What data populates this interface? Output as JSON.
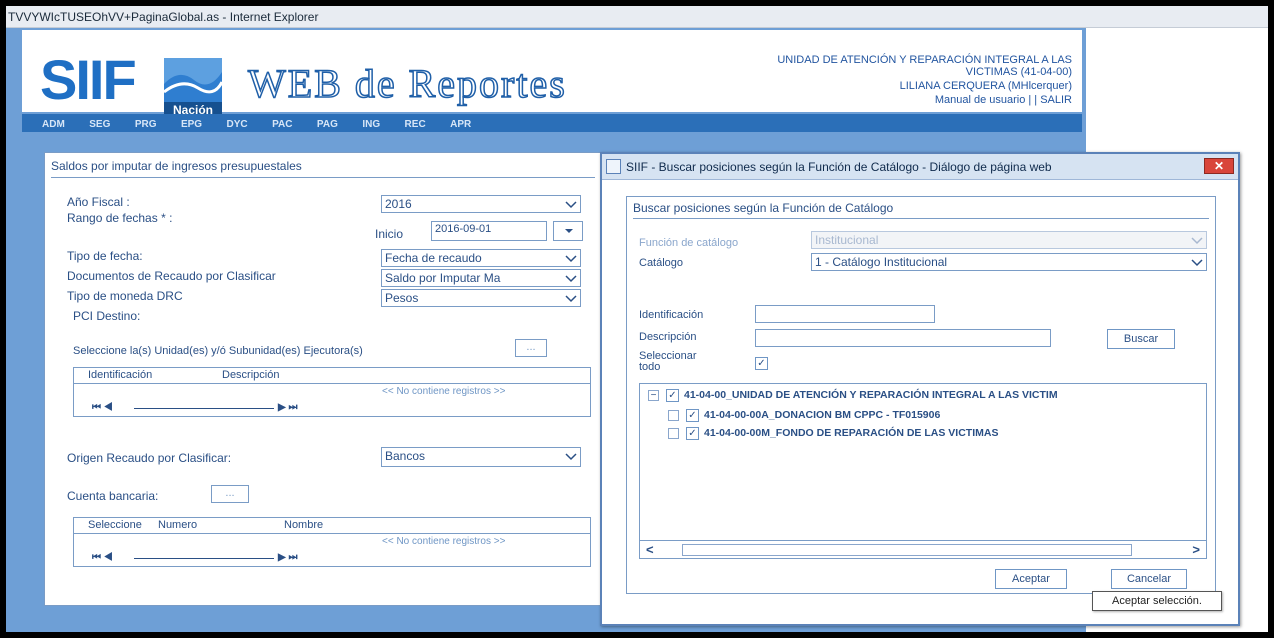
{
  "window": {
    "title": "TVVYWIcTUSEOhVV+PaginaGlobal.as - Internet Explorer"
  },
  "header": {
    "logo_main": "SIIF",
    "logo_sub": "Nación",
    "logo_title": "WEB de Reportes",
    "entity_line1": "UNIDAD DE ATENCIÓN Y REPARACIÓN INTEGRAL A LAS",
    "entity_line2": "VICTIMAS (41-04-00)",
    "user": "LILIANA CERQUERA (MHlcerquer)",
    "links": "Manual de usuario | | SALIR"
  },
  "nav": {
    "items": [
      "ADM",
      "SEG",
      "PRG",
      "EPG",
      "DYC",
      "PAC",
      "PAG",
      "ING",
      "REC",
      "APR"
    ]
  },
  "form": {
    "title": "Saldos por imputar de ingresos presupuestales",
    "anio_label": "Año Fiscal :",
    "anio_value": "2016",
    "rango_label": "Rango de fechas * :",
    "inicio_label": "Inicio",
    "inicio_value": "2016-09-01",
    "tipo_fecha_label": "Tipo de fecha:",
    "tipo_fecha_value": "Fecha de recaudo",
    "docs_label": "Documentos de Recaudo por Clasificar",
    "docs_value": "Saldo por Imputar Ma",
    "moneda_label": "Tipo de moneda DRC",
    "moneda_value": "Pesos",
    "pci_label": "PCI Destino:",
    "unidades_label": "Seleccione la(s) Unidad(es) y/ó Subunidad(es) Ejecutora(s)",
    "unidades_btn": "...",
    "grid1_col1": "Identificación",
    "grid1_col2": "Descripción",
    "grid1_empty": "<< No contiene registros >>",
    "pager_left": "⏮ ◀",
    "pager_right": "▶ ⏭",
    "origen_label": "Origen Recaudo por Clasificar:",
    "origen_value": "Bancos",
    "cuenta_label": "Cuenta bancaria:",
    "cuenta_btn": "...",
    "grid2_col1": "Seleccione",
    "grid2_col2": "Numero",
    "grid2_col3": "Nombre",
    "grid2_empty": "<< No contiene registros >>"
  },
  "dialog": {
    "title": "SIIF - Buscar posiciones según la Función de Catálogo - Diálogo de página web",
    "close": "✕",
    "section_title": "Buscar posiciones según la Función de Catálogo",
    "funcion_label": "Función de catálogo",
    "funcion_value": "Institucional",
    "catalogo_label": "Catálogo",
    "catalogo_value": "1 - Catálogo Institucional",
    "identificacion_label": "Identificación",
    "descripcion_label": "Descripción",
    "buscar": "Buscar",
    "select_all_label_1": "Seleccionar",
    "select_all_label_2": "todo",
    "tree": [
      {
        "label": "41-04-00_UNIDAD DE ATENCIÓN Y REPARACIÓN INTEGRAL A LAS VICTIM",
        "level": 0
      },
      {
        "label": "41-04-00-00A_DONACION BM CPPC - TF015906",
        "level": 1
      },
      {
        "label": "41-04-00-00M_FONDO DE REPARACIÓN DE LAS VICTIMAS",
        "level": 1
      }
    ],
    "aceptar": "Aceptar",
    "cancelar": "Cancelar"
  },
  "tooltip": "Aceptar selección."
}
